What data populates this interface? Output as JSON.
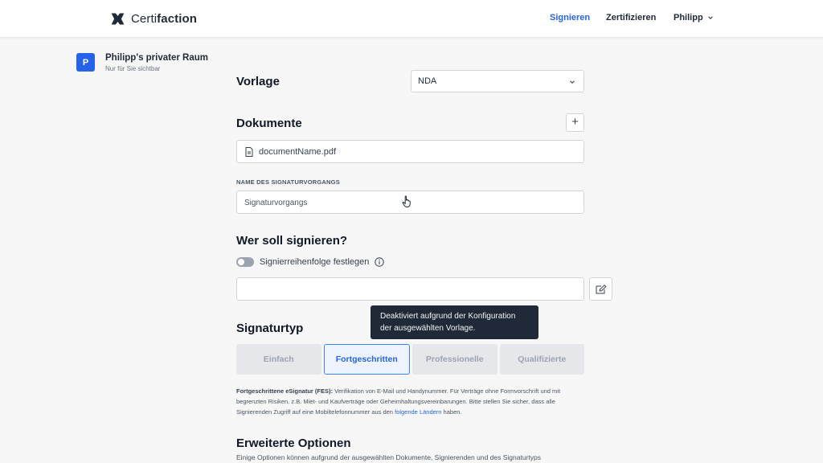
{
  "header": {
    "logo_part1": "Certi",
    "logo_part2": "faction",
    "nav_sign": "Signieren",
    "nav_certify": "Zertifizieren",
    "nav_user": "Philipp"
  },
  "workspace": {
    "avatar_letter": "P",
    "title": "Philipp's privater Raum",
    "subtitle": "Nur für Sie sichtbar"
  },
  "template": {
    "heading": "Vorlage",
    "selected": "NDA"
  },
  "documents": {
    "heading": "Dokumente",
    "add_label": "+",
    "file_name": "documentName.pdf"
  },
  "process": {
    "label": "NAME DES SIGNATURVORGANGS",
    "value": "Signaturvorgangs"
  },
  "signers": {
    "heading": "Wer soll signieren?",
    "order_toggle_label": "Signierreihenfolge festlegen",
    "order_toggle_on": false
  },
  "tooltip": {
    "line1": "Deaktiviert aufgrund der Konfiguration",
    "line2": "der ausgewählten Vorlage."
  },
  "signature_type": {
    "heading": "Signaturtyp",
    "options": [
      "Einfach",
      "Fortgeschritten",
      "Professionelle",
      "Qualifizierte"
    ],
    "selected": "Fortgeschritten",
    "desc_bold": "Fortgeschrittene eSignatur (FES):",
    "desc_text": " Verifikation von E-Mail und Handynummer. Für Verträge ohne Formvorschrift und mit begrenzten Risiken. z.B. Miet- und Kaufverträge oder Geheimhaltungsvereinbarungen. Bitte stellen Sie sicher, dass alle Signierenden Zugriff auf eine Mobiltelefonnummer aus den ",
    "desc_link": "folgende Ländern",
    "desc_end": " haben."
  },
  "advanced": {
    "heading": "Erweiterte Optionen",
    "subtext": "Einige Optionen können aufgrund der ausgewählten Dokumente, Signierenden und des Signaturtyps"
  },
  "colors": {
    "accent": "#2563eb",
    "tooltip_bg": "#1f2937",
    "page_bg": "#f7f7f8"
  }
}
